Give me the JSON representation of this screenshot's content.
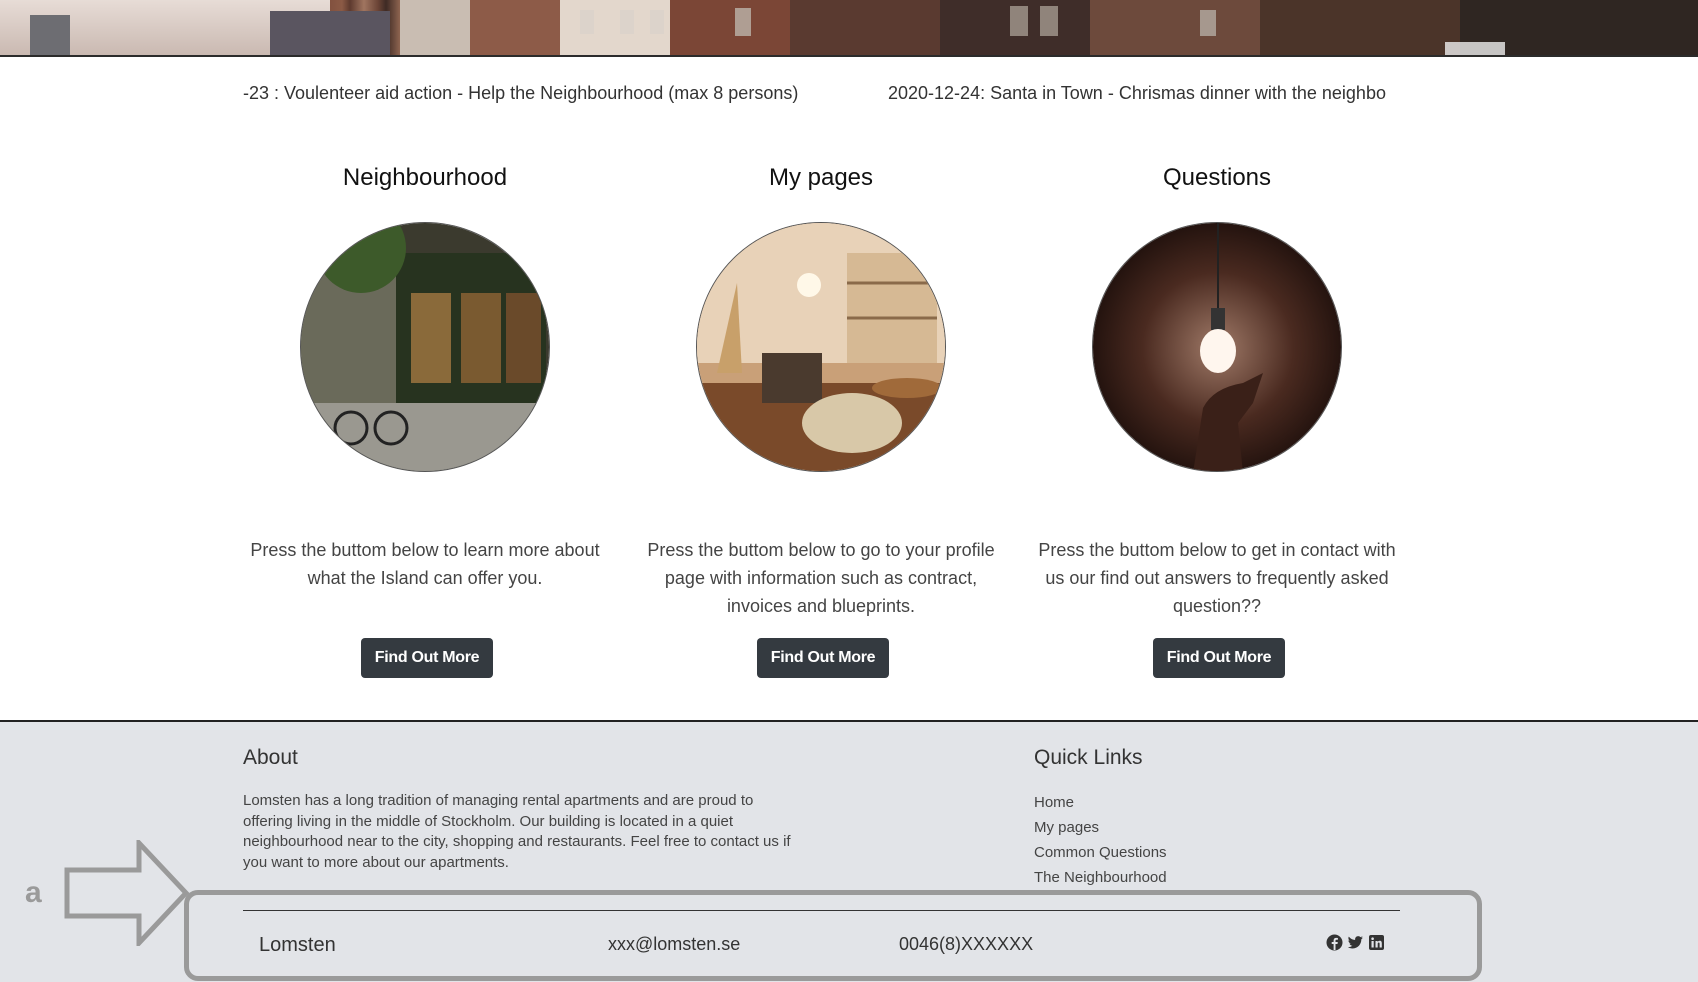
{
  "ticker": {
    "item1": "-23 : Voulenteer aid action - Help the Neighbourhood (max 8 persons)",
    "item2": "2020-12-24: Santa in Town - Chrismas dinner with the neighbo"
  },
  "cards": [
    {
      "title": "Neighbourhood",
      "image_icon": "storefront-photo",
      "text": "Press the buttom below to learn more about what the Island can offer you.",
      "button": "Find Out More"
    },
    {
      "title": "My pages",
      "image_icon": "living-room-photo",
      "text": "Press the buttom below to go to your profile page with information such as contract, invoices and blueprints.",
      "button": "Find Out More"
    },
    {
      "title": "Questions",
      "image_icon": "lightbulb-photo",
      "text": "Press the buttom below to get in contact with us our find out answers to frequently asked question??",
      "button": "Find Out More"
    }
  ],
  "footer": {
    "about_title": "About",
    "about_text": "Lomsten has a long tradition of managing rental apartments and are proud to offering living in the middle of Stockholm. Our building is located in a quiet neighbourhood near to the city, shopping and restaurants. Feel free to contact us if you want to more about our apartments.",
    "links_title": "Quick Links",
    "links": [
      "Home",
      "My pages",
      "Common Questions",
      "The Neighbourhood"
    ],
    "brand": "Lomsten",
    "email": "xxx@lomsten.se",
    "phone": "0046(8)XXXXXX",
    "social_icons": [
      "facebook-icon",
      "twitter-icon",
      "linkedin-icon"
    ]
  },
  "annotation": {
    "label": "a"
  },
  "colors": {
    "button_bg": "#343a40",
    "footer_bg": "#e2e4e8",
    "annotation": "#9a9a9a"
  }
}
